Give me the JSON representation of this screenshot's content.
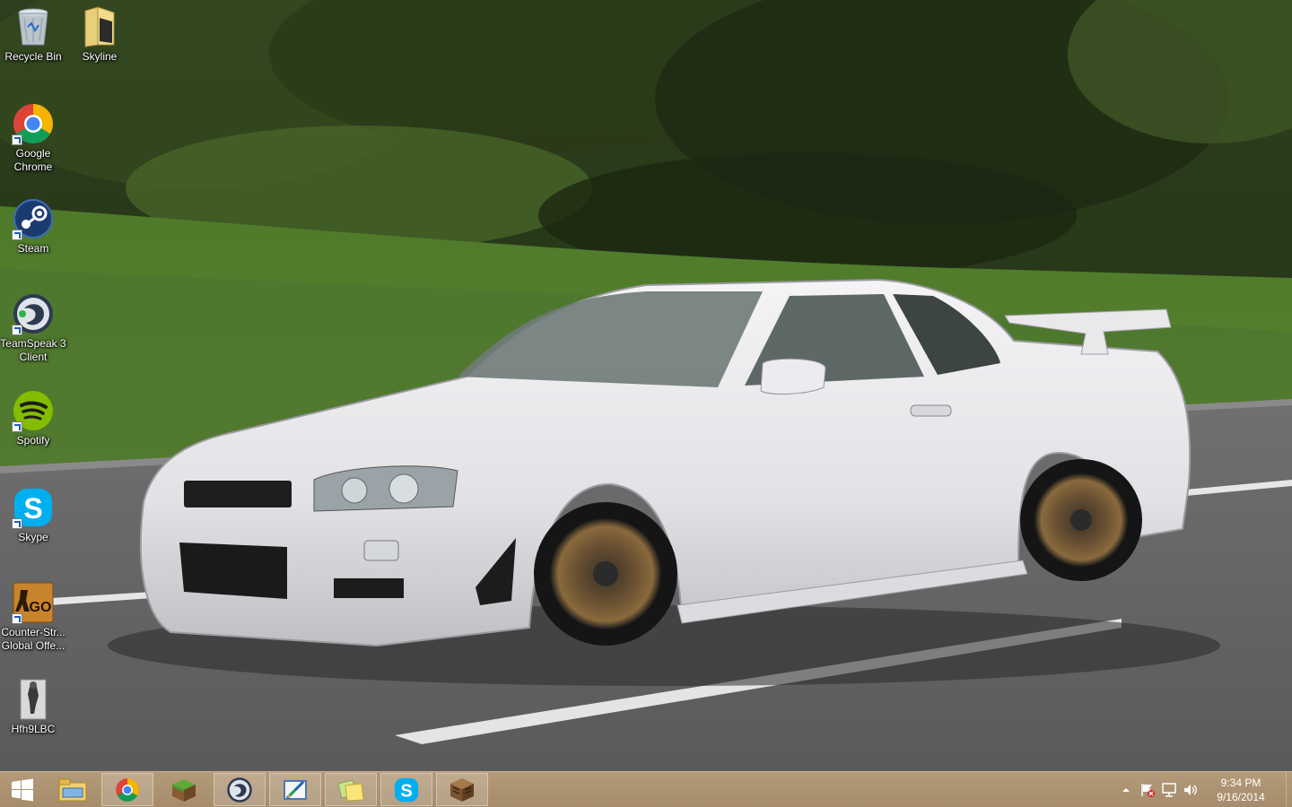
{
  "desktop": {
    "icons": [
      {
        "label": "Recycle Bin"
      },
      {
        "label": "Skyline"
      },
      {
        "label": "Google\nChrome"
      },
      {
        "label": "Steam"
      },
      {
        "label": "TeamSpeak 3\nClient"
      },
      {
        "label": "Spotify"
      },
      {
        "label": "Skype"
      },
      {
        "label": "Counter-Str...\nGlobal Offe..."
      },
      {
        "label": "Hfh9LBC"
      }
    ]
  },
  "taskbar": {
    "apps": [
      {
        "name": "file-explorer-icon"
      },
      {
        "name": "chrome-icon"
      },
      {
        "name": "minecraft-grass-icon"
      },
      {
        "name": "teamspeak-icon"
      },
      {
        "name": "paint-icon"
      },
      {
        "name": "sticky-notes-icon"
      },
      {
        "name": "skype-icon"
      },
      {
        "name": "crafting-table-icon"
      }
    ],
    "clock": {
      "time": "9:34 PM",
      "date": "9/16/2014"
    }
  },
  "colors": {
    "taskbar": "#a68c6b",
    "accent": "#1b5fbf"
  }
}
